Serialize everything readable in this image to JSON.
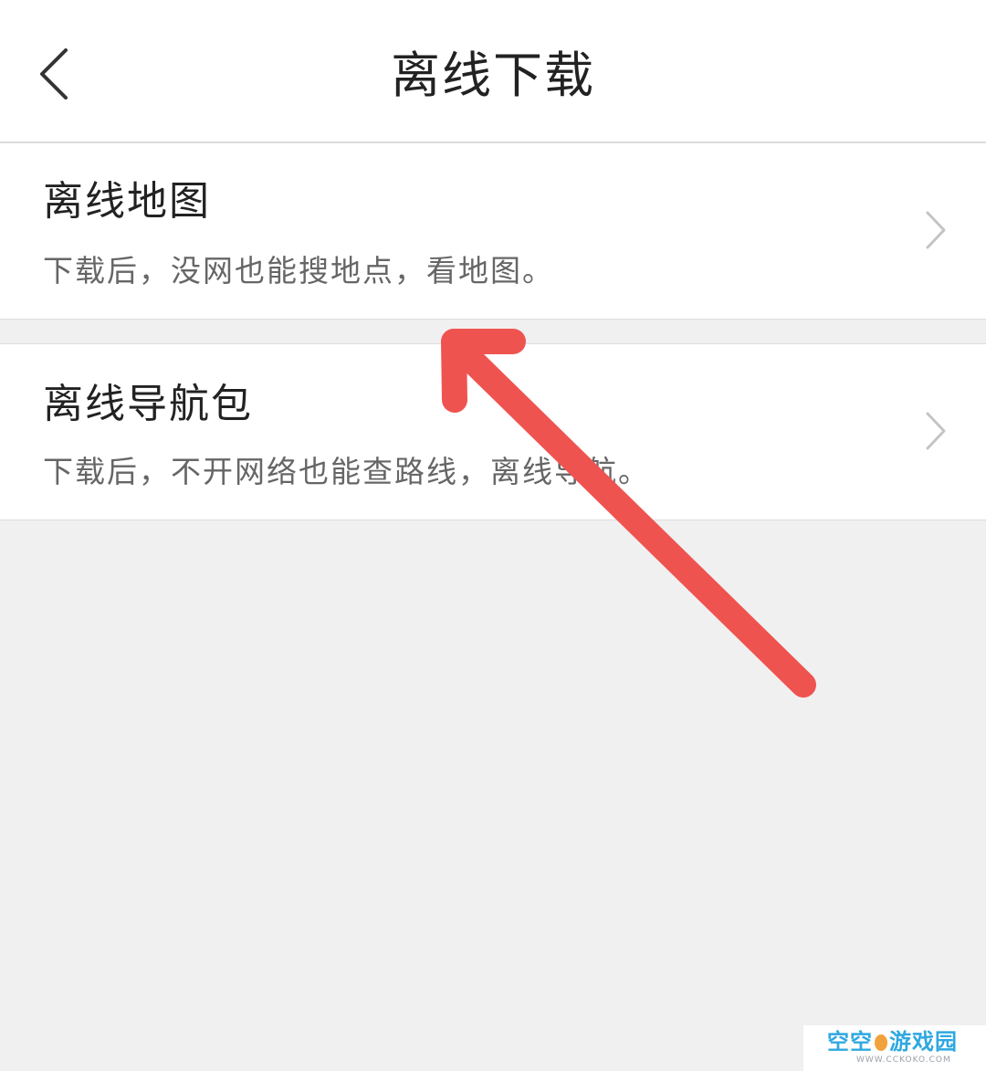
{
  "header": {
    "title": "离线下载",
    "back_icon": "chevron-left-icon"
  },
  "items": [
    {
      "title": "离线地图",
      "description": "下载后，没网也能搜地点，看地图。",
      "icon": "chevron-right-icon"
    },
    {
      "title": "离线导航包",
      "description": "下载后，不开网络也能查路线，离线导航。",
      "icon": "chevron-right-icon"
    }
  ],
  "annotation": {
    "type": "arrow",
    "color": "#ef5350"
  },
  "watermark": {
    "text_left": "空空",
    "text_right": "游戏园",
    "url": "WWW.CCKOKO.COM"
  }
}
